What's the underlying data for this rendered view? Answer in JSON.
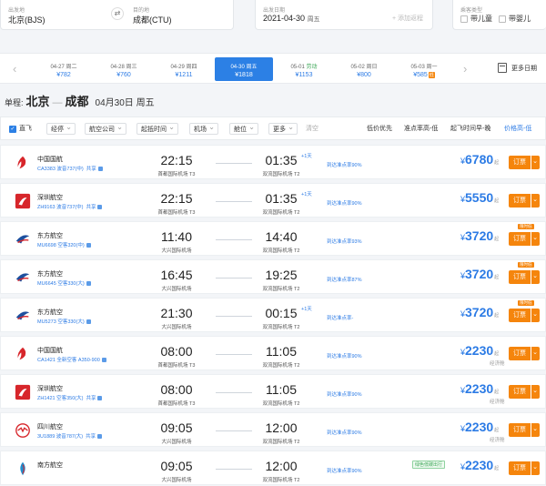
{
  "search": {
    "from": {
      "label": "出发地",
      "value": "北京(BJS)"
    },
    "to": {
      "label": "目的地",
      "value": "成都(CTU)"
    },
    "swap_icon": "swap-arrows-icon",
    "date": {
      "label": "出发日期",
      "value": "2021-04-30",
      "weekday": "周五",
      "return_placeholder": "+ 添加返程"
    },
    "passenger": {
      "label": "乘客类型",
      "child": "带儿童",
      "infant": "带婴儿"
    }
  },
  "dates": [
    {
      "date": "04-27",
      "weekday": "周二",
      "price": "¥782",
      "holiday": false,
      "active": false,
      "tag": ""
    },
    {
      "date": "04-28",
      "weekday": "周三",
      "price": "¥760",
      "holiday": false,
      "active": false,
      "tag": ""
    },
    {
      "date": "04-29",
      "weekday": "周四",
      "price": "¥1211",
      "holiday": false,
      "active": false,
      "tag": ""
    },
    {
      "date": "04-30",
      "weekday": "周五",
      "price": "¥1818",
      "holiday": false,
      "active": true,
      "tag": ""
    },
    {
      "date": "05-01",
      "weekday": "劳动",
      "price": "¥1153",
      "holiday": true,
      "active": false,
      "tag": ""
    },
    {
      "date": "05-02",
      "weekday": "周日",
      "price": "¥800",
      "holiday": false,
      "active": false,
      "tag": ""
    },
    {
      "date": "05-03",
      "weekday": "周一",
      "price": "¥585",
      "holiday": false,
      "active": false,
      "tag": "低"
    }
  ],
  "more_dates": "更多日期",
  "route": {
    "type": "单程:",
    "from": "北京",
    "to": "成都",
    "date": "04月30日 周五"
  },
  "filters": {
    "direct": "直飞",
    "stops": "经停",
    "airline": "航空公司",
    "depart_time": "起抵时间",
    "airport": "机场",
    "cabin": "舱位",
    "more": "更多",
    "clear": "清空",
    "sort_low": "低价优先",
    "sort_ontime": "准点率高-低",
    "sort_departure": "起飞时间早-晚",
    "sort_price": "价格高-低"
  },
  "flights": [
    {
      "airline": "中国国航",
      "logo": "air-china-logo",
      "color": "#d7262b",
      "flight_no": "CA3383 波音737(中)",
      "share": "共享",
      "dep_time": "22:15",
      "dep_airport": "首都国际机场 T3",
      "arr_time": "01:35",
      "plus_day": "+1天",
      "arr_airport": "双流国际机场 T2",
      "ontime": "到达准点率90%",
      "price": "6780",
      "cabin": "",
      "book": "订票",
      "low_tag": "",
      "green_tag": ""
    },
    {
      "airline": "深圳航空",
      "logo": "shenzhen-airlines-logo",
      "color": "#d7262b",
      "flight_no": "ZH9163 波音737(中)",
      "share": "共享",
      "dep_time": "22:15",
      "dep_airport": "首都国际机场 T3",
      "arr_time": "01:35",
      "plus_day": "+1天",
      "arr_airport": "双流国际机场 T2",
      "ontime": "到达准点率90%",
      "price": "5550",
      "cabin": "",
      "book": "订票",
      "low_tag": "",
      "green_tag": ""
    },
    {
      "airline": "东方航空",
      "logo": "china-eastern-logo",
      "color": "#1d4f9e",
      "flight_no": "MU6698 空客320(中)",
      "share": "",
      "dep_time": "11:40",
      "dep_airport": "大兴国际机场",
      "arr_time": "14:40",
      "plus_day": "",
      "arr_airport": "双流国际机场 T2",
      "ontime": "到达准点率93%",
      "price": "3720",
      "cabin": "",
      "book": "订票",
      "low_tag": "限时低",
      "green_tag": ""
    },
    {
      "airline": "东方航空",
      "logo": "china-eastern-logo",
      "color": "#1d4f9e",
      "flight_no": "MU6645 空客330(大)",
      "share": "",
      "dep_time": "16:45",
      "dep_airport": "大兴国际机场",
      "arr_time": "19:25",
      "plus_day": "",
      "arr_airport": "双流国际机场 T2",
      "ontime": "到达准点率87%",
      "price": "3720",
      "cabin": "",
      "book": "订票",
      "low_tag": "限时低",
      "green_tag": ""
    },
    {
      "airline": "东方航空",
      "logo": "china-eastern-logo",
      "color": "#1d4f9e",
      "flight_no": "MU5273 空客330(大)",
      "share": "",
      "dep_time": "21:30",
      "dep_airport": "大兴国际机场",
      "arr_time": "00:15",
      "plus_day": "+1天",
      "arr_airport": "双流国际机场 T2",
      "ontime": "到达准点率-",
      "price": "3720",
      "cabin": "",
      "book": "订票",
      "low_tag": "限时低",
      "green_tag": ""
    },
    {
      "airline": "中国国航",
      "logo": "air-china-logo",
      "color": "#d7262b",
      "flight_no": "CA1421 全新空客 A350-900",
      "share": "",
      "dep_time": "08:00",
      "dep_airport": "首都国际机场 T3",
      "arr_time": "11:05",
      "plus_day": "",
      "arr_airport": "双流国际机场 T2",
      "ontime": "到达准点率90%",
      "price": "2230",
      "cabin": "经济舱",
      "book": "订票",
      "low_tag": "",
      "green_tag": ""
    },
    {
      "airline": "深圳航空",
      "logo": "shenzhen-airlines-logo",
      "color": "#d7262b",
      "flight_no": "ZH1421 空客350(大)",
      "share": "共享",
      "dep_time": "08:00",
      "dep_airport": "首都国际机场 T3",
      "arr_time": "11:05",
      "plus_day": "",
      "arr_airport": "双流国际机场 T2",
      "ontime": "到达准点率90%",
      "price": "2230",
      "cabin": "经济舱",
      "book": "订票",
      "low_tag": "",
      "green_tag": ""
    },
    {
      "airline": "四川航空",
      "logo": "sichuan-airlines-logo",
      "color": "#d7262b",
      "flight_no": "3U1889 波音787(大)",
      "share": "共享",
      "dep_time": "09:05",
      "dep_airport": "大兴国际机场",
      "arr_time": "12:00",
      "plus_day": "",
      "arr_airport": "双流国际机场 T2",
      "ontime": "到达准点率90%",
      "price": "2230",
      "cabin": "经济舱",
      "book": "订票",
      "low_tag": "",
      "green_tag": ""
    },
    {
      "airline": "南方航空",
      "logo": "china-southern-logo",
      "color": "#1f8fd0",
      "flight_no": "",
      "share": "",
      "dep_time": "09:05",
      "dep_airport": "大兴国际机场",
      "arr_time": "12:00",
      "plus_day": "",
      "arr_airport": "双流国际机场 T2",
      "ontime": "到达准点率90%",
      "price": "2230",
      "cabin": "",
      "book": "订票",
      "low_tag": "",
      "green_tag": "绿色低碳出行"
    }
  ],
  "price_suffix": "起",
  "currency": "¥"
}
